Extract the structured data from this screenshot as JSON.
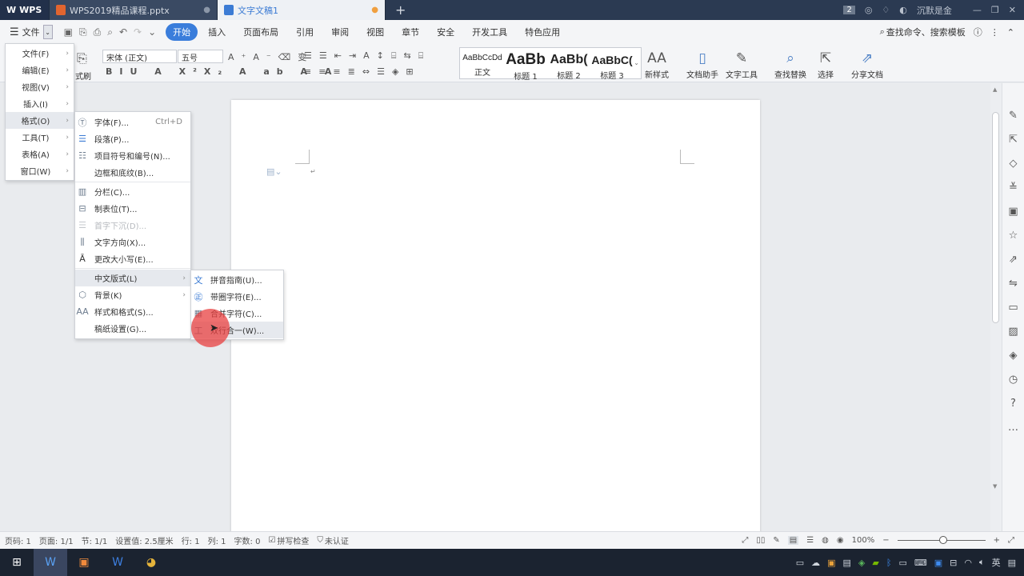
{
  "titlebar": {
    "app_label": "WPS",
    "tabs": [
      {
        "label": "WPS2019精品课程.pptx",
        "icon": "ppt-icon",
        "color": "#e2652f",
        "dot": "●"
      },
      {
        "label": "文字文稿1",
        "icon": "word-icon",
        "color": "#3b7bd4",
        "dot": "●"
      }
    ],
    "add_tab": "+",
    "badge": "2",
    "user": "沉默是金"
  },
  "menubar": {
    "file_label": "文件",
    "tabs": [
      "开始",
      "插入",
      "页面布局",
      "引用",
      "审阅",
      "视图",
      "章节",
      "安全",
      "开发工具",
      "特色应用"
    ],
    "active_tab": "开始",
    "search_label": "查找命令、搜索模板"
  },
  "ribbon": {
    "format_painter": "式刷",
    "font_name": "宋体 (正文)",
    "font_size": "五号",
    "styles": [
      {
        "preview": "AaBbCcDd",
        "label": "正文"
      },
      {
        "preview": "AaBb",
        "label": "标题 1"
      },
      {
        "preview": "AaBb(",
        "label": "标题 2"
      },
      {
        "preview": "AaBbC(",
        "label": "标题 3"
      }
    ],
    "new_style": "新样式",
    "buttons": [
      "文档助手",
      "文字工具",
      "查找替换",
      "选择",
      "分享文档"
    ]
  },
  "file_menu": {
    "items": [
      {
        "label": "文件(F)",
        "arrow": "›"
      },
      {
        "label": "编辑(E)",
        "arrow": "›"
      },
      {
        "label": "视图(V)",
        "arrow": "›"
      },
      {
        "label": "插入(I)",
        "arrow": "›"
      },
      {
        "label": "格式(O)",
        "arrow": "›"
      },
      {
        "label": "工具(T)",
        "arrow": "›"
      },
      {
        "label": "表格(A)",
        "arrow": "›"
      },
      {
        "label": "窗口(W)",
        "arrow": "›"
      }
    ]
  },
  "format_menu": {
    "items": [
      {
        "label": "字体(F)...",
        "shortcut": "Ctrl+D"
      },
      {
        "label": "段落(P)..."
      },
      {
        "label": "项目符号和编号(N)..."
      },
      {
        "label": "边框和底纹(B)..."
      },
      {
        "label": "分栏(C)..."
      },
      {
        "label": "制表位(T)..."
      },
      {
        "label": "首字下沉(D)..."
      },
      {
        "label": "文字方向(X)..."
      },
      {
        "label": "更改大小写(E)..."
      },
      {
        "label": "中文版式(L)",
        "arrow": "›"
      },
      {
        "label": "背景(K)",
        "arrow": "›"
      },
      {
        "label": "样式和格式(S)..."
      },
      {
        "label": "稿纸设置(G)..."
      }
    ]
  },
  "chinese_layout_menu": {
    "items": [
      {
        "label": "拼音指南(U)..."
      },
      {
        "label": "带圈字符(E)..."
      },
      {
        "label": "合并字符(C)..."
      },
      {
        "label": "双行合一(W)..."
      }
    ]
  },
  "document": {
    "paragraph_mark": "↵"
  },
  "statusbar": {
    "page_code": "页码: 1",
    "page": "页面: 1/1",
    "section": "节: 1/1",
    "setting": "设置值: 2.5厘米",
    "row": "行: 1",
    "col": "列: 1",
    "word_count": "字数: 0",
    "spell_check": "拼写检查",
    "unverified": "未认证",
    "zoom": "100%",
    "zoom_minus": "−",
    "zoom_plus": "+"
  },
  "taskbar": {
    "ime": "英"
  },
  "colors": {
    "accent": "#3a7ddb",
    "titlebar": "#2b3a52",
    "cursor_highlight": "#e84040"
  }
}
